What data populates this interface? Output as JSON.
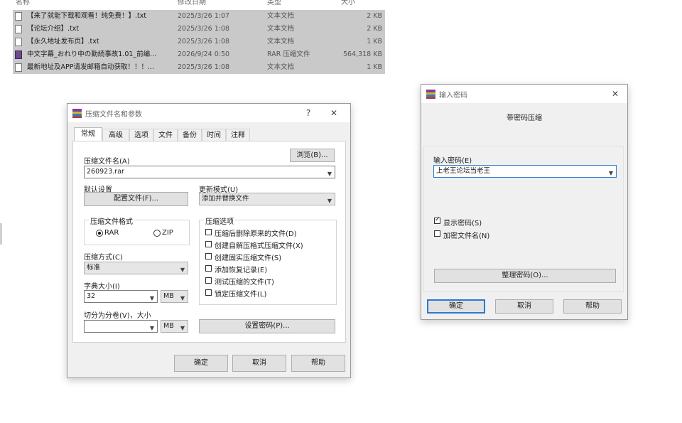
{
  "explorer": {
    "columns": {
      "name": "名称",
      "date": "修改日期",
      "type": "类型",
      "size": "大小"
    },
    "files": [
      {
        "icon": "text-file-icon",
        "name": "【来了就能下载和观看！纯免费！】.txt",
        "date": "2025/3/26 1:07",
        "type": "文本文档",
        "size": "2 KB"
      },
      {
        "icon": "text-file-icon",
        "name": "【论坛介绍】.txt",
        "date": "2025/3/26 1:08",
        "type": "文本文档",
        "size": "2 KB"
      },
      {
        "icon": "text-file-icon",
        "name": "【永久地址发布页】.txt",
        "date": "2025/3/26 1:08",
        "type": "文本文档",
        "size": "1 KB"
      },
      {
        "icon": "rar-archive-icon",
        "name": "中文字幕_おれり中の勤続事故1.01_前编...",
        "date": "2026/9/24 0:50",
        "type": "RAR 压缩文件",
        "size": "564,318 KB"
      },
      {
        "icon": "text-file-icon",
        "name": "最新地址及APP请发邮箱自动获取！！！...",
        "date": "2025/3/26 1:08",
        "type": "文本文档",
        "size": "1 KB"
      }
    ]
  },
  "archive_dialog": {
    "title": "压缩文件名和参数",
    "help_glyph": "?",
    "close_glyph": "✕",
    "tabs": [
      "常规",
      "高级",
      "选项",
      "文件",
      "备份",
      "时间",
      "注释"
    ],
    "active_tab": "常规",
    "archive_name_label": "压缩文件名(A)",
    "browse_label": "浏览(B)...",
    "archive_name_value": "260923.rar",
    "default_settings_label": "默认设置",
    "profiles_button": "配置文件(F)...",
    "update_mode_label": "更新模式(U)",
    "update_mode_value": "添加并替换文件",
    "format_group": "压缩文件格式",
    "format_rar": "RAR",
    "format_zip": "ZIP",
    "format_selected": "RAR",
    "method_label": "压缩方式(C)",
    "method_value": "标准",
    "dict_label": "字典大小(I)",
    "dict_value": "32",
    "dict_unit": "MB",
    "split_label": "切分为分卷(V)，大小",
    "split_value": "",
    "split_unit": "MB",
    "options_group": "压缩选项",
    "options": [
      {
        "label": "压缩后删除原来的文件(D)",
        "checked": false
      },
      {
        "label": "创建自解压格式压缩文件(X)",
        "checked": false
      },
      {
        "label": "创建固实压缩文件(S)",
        "checked": false
      },
      {
        "label": "添加恢复记录(E)",
        "checked": false
      },
      {
        "label": "测试压缩的文件(T)",
        "checked": false
      },
      {
        "label": "锁定压缩文件(L)",
        "checked": false
      }
    ],
    "set_password_button": "设置密码(P)...",
    "ok_button": "确定",
    "cancel_button": "取消",
    "help_button": "帮助"
  },
  "password_dialog": {
    "title": "输入密码",
    "close_glyph": "✕",
    "heading": "带密码压缩",
    "password_label": "输入密码(E)",
    "password_value": "上老王论坛当老王",
    "show_password_label": "显示密码(S)",
    "show_password_checked": true,
    "encrypt_names_label": "加密文件名(N)",
    "encrypt_names_checked": false,
    "organize_button": "整理密码(O)...",
    "ok_button": "确定",
    "cancel_button": "取消",
    "help_button": "帮助"
  }
}
